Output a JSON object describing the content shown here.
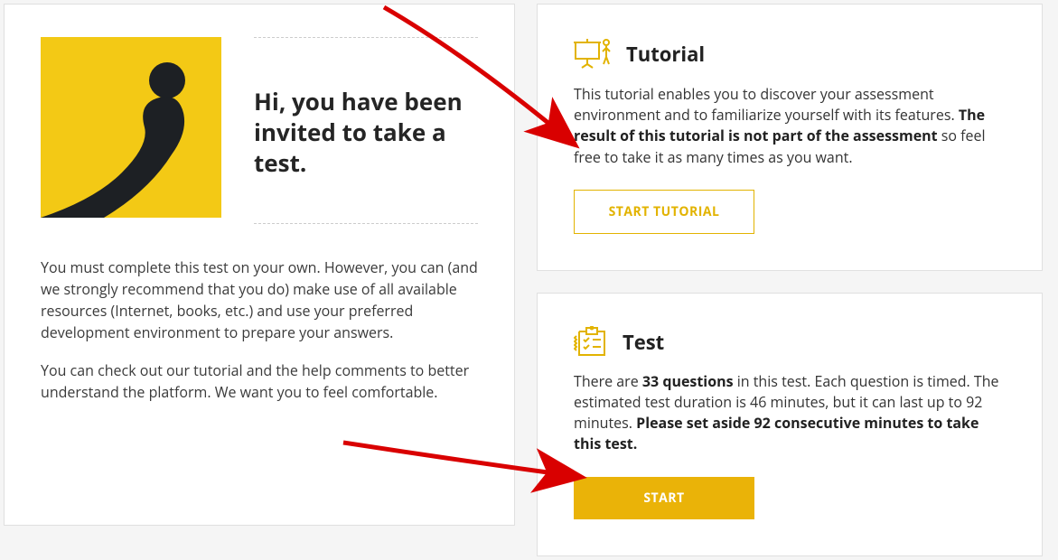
{
  "intro": {
    "heading": "Hi, you have been invited to take a test.",
    "paragraph1": "You must complete this test on your own. However, you can (and we strongly recommend that you do) make use of all available resources (Internet, books, etc.) and use your preferred development environment to prepare your answers.",
    "paragraph2": "You can check out our tutorial and the help comments to better understand the platform. We want you to feel comfortable."
  },
  "tutorial": {
    "title": "Tutorial",
    "body_pre": "This tutorial enables you to discover your assessment environment and to familiarize yourself with its features. ",
    "body_bold": "The result of this tutorial is not part of the assessment",
    "body_post": " so feel free to take it as many times as you want.",
    "button_label": "START TUTORIAL"
  },
  "test": {
    "title": "Test",
    "body_pre": "There are ",
    "body_q_count": "33 questions",
    "body_mid": " in this test. Each question is timed. The estimated test duration is 46 minutes, but it can last up to 92 minutes. ",
    "body_bold": "Please set aside 92 consecutive minutes to take this test.",
    "button_label": "START"
  }
}
